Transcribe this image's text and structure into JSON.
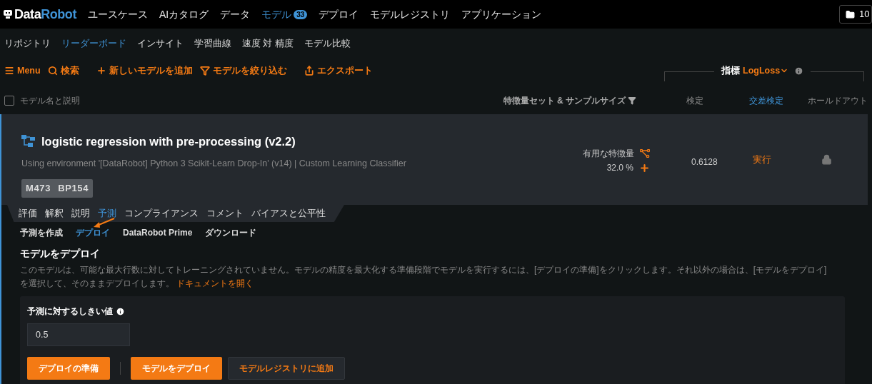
{
  "brand": {
    "prefix": "Data",
    "suffix": "Robot"
  },
  "nav": [
    {
      "label": "ユースケース",
      "selected": false
    },
    {
      "label": "AIカタログ",
      "selected": false
    },
    {
      "label": "データ",
      "selected": false
    },
    {
      "label": "モデル",
      "selected": true,
      "badge": "33"
    },
    {
      "label": "デプロイ",
      "selected": false
    },
    {
      "label": "モデルレジストリ",
      "selected": false
    },
    {
      "label": "アプリケーション",
      "selected": false
    }
  ],
  "project_button": {
    "label": "10"
  },
  "subnav": [
    {
      "label": "リポジトリ",
      "selected": false
    },
    {
      "label": "リーダーボード",
      "selected": true
    },
    {
      "label": "インサイト",
      "selected": false
    },
    {
      "label": "学習曲線",
      "selected": false
    },
    {
      "label": "速度 対 精度",
      "selected": false
    },
    {
      "label": "モデル比較",
      "selected": false
    }
  ],
  "toolbar": [
    {
      "kind": "menu",
      "label": "Menu"
    },
    {
      "kind": "search",
      "label": "検索"
    },
    {
      "kind": "add",
      "label": "新しいモデルを追加"
    },
    {
      "kind": "filter",
      "label": "モデルを絞り込む"
    },
    {
      "kind": "export",
      "label": "エクスポート"
    }
  ],
  "metric": {
    "label": "指標",
    "value": "LogLoss"
  },
  "columns": {
    "select_all": {
      "checked": false
    },
    "name": "モデル名と説明",
    "features": "特徴量セット & サンプルサイズ",
    "validation": "検定",
    "cross_validation": {
      "label": "交差検定",
      "selected": true
    },
    "holdout": "ホールドアウト"
  },
  "model": {
    "title": "logistic regression with pre-processing (v2.2)",
    "description": "Using environment '[DataRobot] Python 3 Scikit-Learn Drop-In' (v14) | Custom Learning Classifier",
    "tags": [
      "M473",
      "BP154"
    ],
    "feature_label": "有用な特徴量",
    "sample_size": "32.0 %",
    "validation": "0.6128",
    "cross_validation": "実行",
    "holdout_locked": true
  },
  "tabs": [
    {
      "label": "評価",
      "selected": false
    },
    {
      "label": "解釈",
      "selected": false
    },
    {
      "label": "説明",
      "selected": false
    },
    {
      "label": "予測",
      "selected": true
    },
    {
      "label": "コンプライアンス",
      "selected": false
    },
    {
      "label": "コメント",
      "selected": false
    },
    {
      "label": "バイアスと公平性",
      "selected": false
    }
  ],
  "subtabs": [
    {
      "label": "予測を作成",
      "selected": false
    },
    {
      "label": "デプロイ",
      "selected": true
    },
    {
      "label": "DataRobot Prime",
      "selected": false
    },
    {
      "label": "ダウンロード",
      "selected": false
    }
  ],
  "deploy": {
    "title": "モデルをデプロイ",
    "text": "このモデルは、可能な最大行数に対してトレーニングされていません。モデルの精度を最大化する準備段階でモデルを実行するには、[デプロイの準備]をクリックします。それ以外の場合は、[モデルをデプロイ]を選択して、そのままデプロイします。",
    "link": "ドキュメントを開く",
    "threshold_label": "予測に対するしきい値",
    "threshold_value": "0.5",
    "buttons": [
      {
        "kind": "primary",
        "label": "デプロイの準備"
      },
      {
        "kind": "divider"
      },
      {
        "kind": "primary",
        "label": "モデルをデプロイ"
      },
      {
        "kind": "secondary",
        "label": "モデルレジストリに追加"
      }
    ]
  }
}
